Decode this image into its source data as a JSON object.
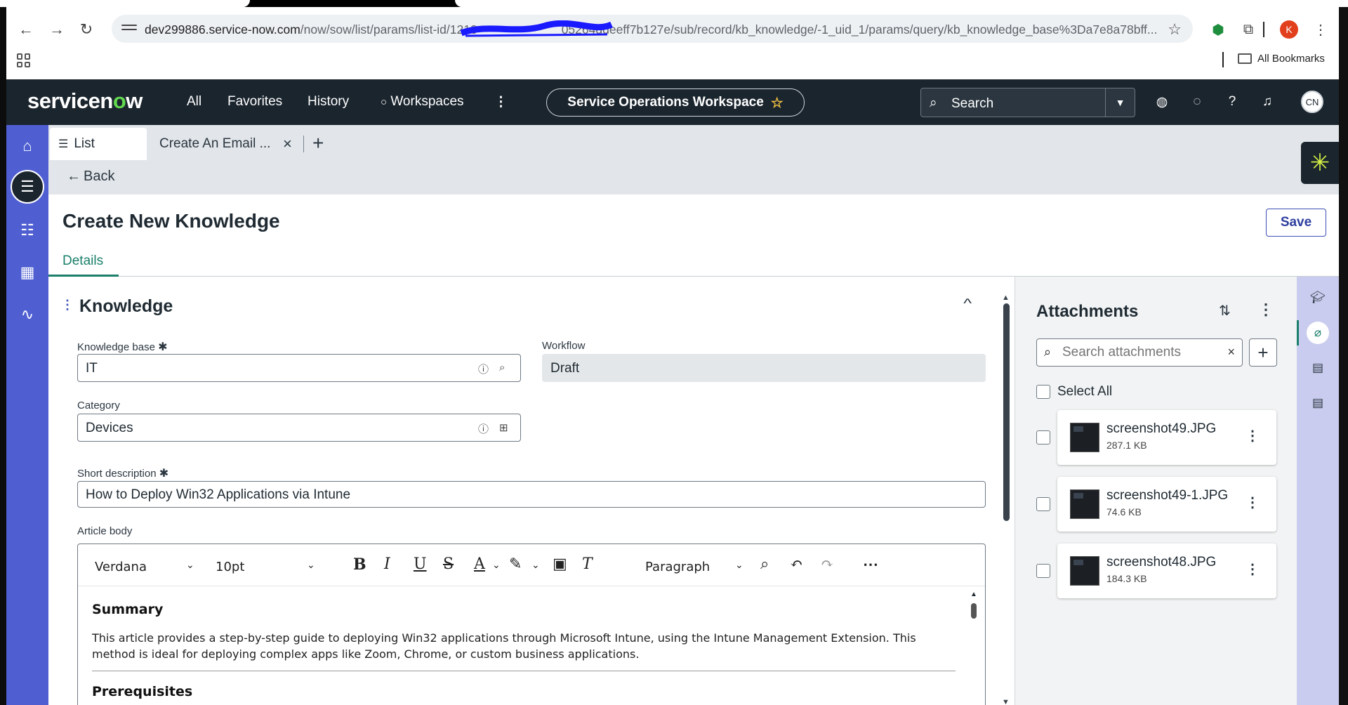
{
  "browser": {
    "url_host": "dev299886.service-now.com",
    "url_path": "/now/sow/list/params/list-id/1210",
    "url_tail": "05264ddeeff7b127e/sub/record/kb_knowledge/-1_uid_1/params/query/kb_knowledge_base%3Da7e8a78bff...",
    "avatar_letter": "K",
    "bookmarks_label": "All Bookmarks"
  },
  "header": {
    "logo_prefix": "servicen",
    "logo_o": "o",
    "logo_suffix": "w",
    "nav": [
      "All",
      "Favorites",
      "History",
      "Workspaces"
    ],
    "workspace_title": "Service Operations Workspace",
    "search_placeholder": "Search",
    "user_initials": "CN"
  },
  "tabs": {
    "list_label": "List",
    "email_tab_label": "Create An Email ...",
    "back_label": "Back"
  },
  "record": {
    "title": "Create New Knowledge",
    "save_label": "Save",
    "details_tab": "Details"
  },
  "form": {
    "section_title": "Knowledge",
    "kb_label": "Knowledge base",
    "kb_value": "IT",
    "workflow_label": "Workflow",
    "workflow_value": "Draft",
    "category_label": "Category",
    "category_value": "Devices",
    "short_desc_label": "Short description",
    "short_desc_value": "How to Deploy Win32 Applications via Intune",
    "article_body_label": "Article body",
    "required_mark": "✱"
  },
  "editor": {
    "font": "Verdana",
    "size": "10pt",
    "block": "Paragraph",
    "summary_heading": "Summary",
    "summary_text": "This article provides a step-by-step guide to deploying Win32 applications through Microsoft Intune, using the Intune Management Extension. This method is ideal for deploying complex apps like Zoom, Chrome, or custom business applications.",
    "next_heading": "Prerequisites"
  },
  "attachments": {
    "title": "Attachments",
    "search_placeholder": "Search attachments",
    "select_all": "Select All",
    "files": [
      {
        "name": "screenshot49.JPG",
        "size": "287.1 KB"
      },
      {
        "name": "screenshot49-1.JPG",
        "size": "74.6 KB"
      },
      {
        "name": "screenshot48.JPG",
        "size": "184.3 KB"
      }
    ]
  },
  "colors": {
    "accent_teal": "#1b7f6a",
    "rail_purple": "#4f5fd2",
    "header_dark": "#1b252e",
    "logo_green": "#62d84e"
  }
}
